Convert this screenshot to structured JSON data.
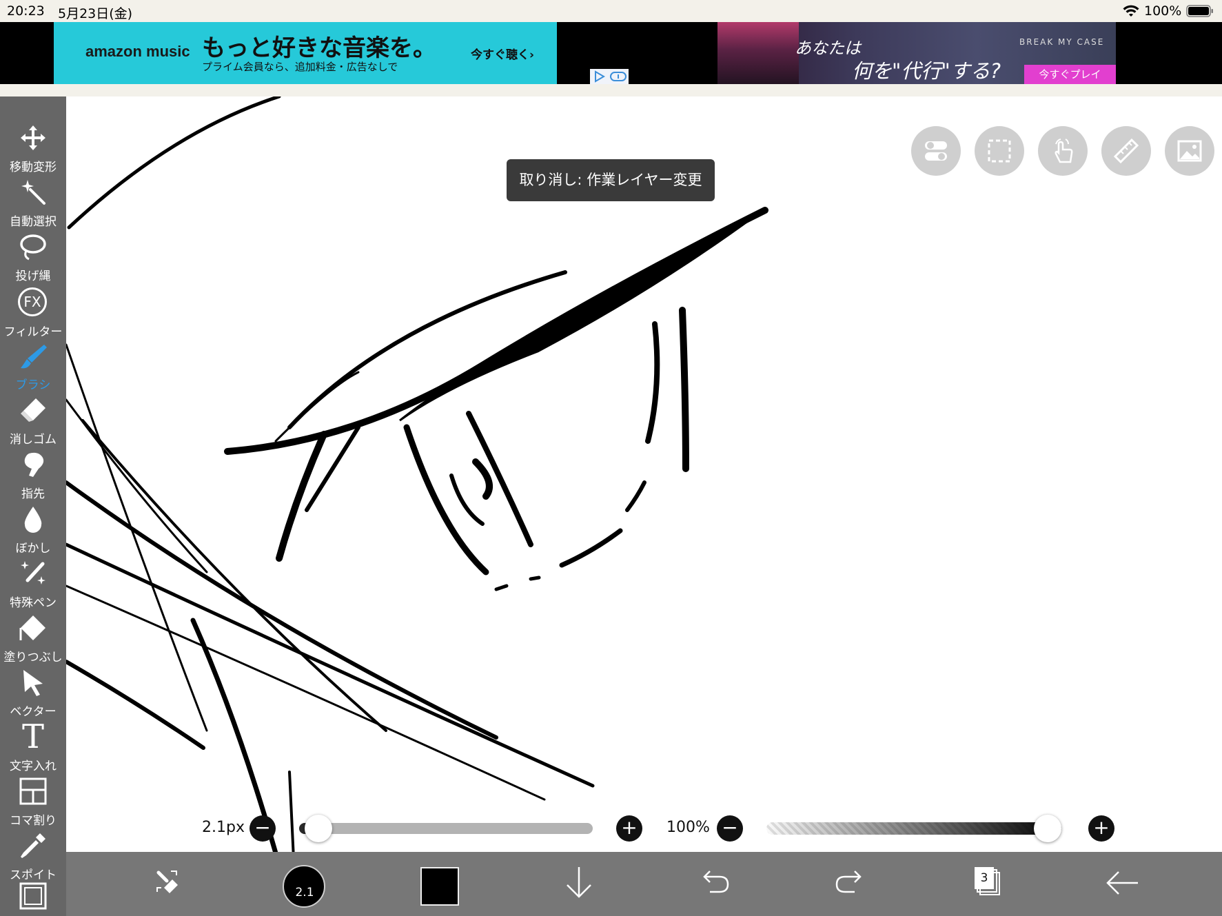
{
  "status_bar": {
    "time": "20:23",
    "date": "5月23日(金)",
    "battery_percent": "100%"
  },
  "ads": {
    "ad1": {
      "brand": "amazon music",
      "headline": "もっと好きな音楽を。",
      "sub": "プライム会員なら、追加料金・広告なしで",
      "cta": "今すぐ聴く›"
    },
    "ad2": {
      "line1": "あなたは",
      "line2": "何を\"代行\"する?",
      "logo": "BREAK MY CASE",
      "cta": "今すぐプレイ"
    }
  },
  "toolbar": {
    "tools": [
      {
        "label": "移動変形",
        "icon": "move-icon"
      },
      {
        "label": "自動選択",
        "icon": "magic-wand-icon"
      },
      {
        "label": "投げ縄",
        "icon": "lasso-icon"
      },
      {
        "label": "フィルター",
        "icon": "fx-icon",
        "glyph": "FX"
      },
      {
        "label": "ブラシ",
        "icon": "brush-icon",
        "active": true
      },
      {
        "label": "消しゴム",
        "icon": "eraser-icon"
      },
      {
        "label": "指先",
        "icon": "smudge-icon"
      },
      {
        "label": "ぼかし",
        "icon": "blur-drop-icon"
      },
      {
        "label": "特殊ペン",
        "icon": "special-pen-icon"
      },
      {
        "label": "塗りつぶし",
        "icon": "fill-bucket-icon"
      },
      {
        "label": "ベクター",
        "icon": "vector-cursor-icon"
      },
      {
        "label": "文字入れ",
        "icon": "text-icon",
        "glyph": "T"
      },
      {
        "label": "コマ割り",
        "icon": "panel-divide-icon"
      },
      {
        "label": "スポイト",
        "icon": "eyedropper-icon"
      },
      {
        "label": "",
        "icon": "canvas-frame-icon"
      }
    ],
    "active_color": "#2d9ae6"
  },
  "toast": {
    "text": "取り消し: 作業レイヤー変更"
  },
  "top_right_buttons": [
    "toggle-icon",
    "selection-rect-icon",
    "touch-hand-icon",
    "ruler-icon",
    "image-icon"
  ],
  "brush_size": {
    "label": "2.1px",
    "value_fraction": 0.02
  },
  "opacity": {
    "label": "100%",
    "value_fraction": 1.0
  },
  "bottom_bar": {
    "brush_size_badge": "2.1",
    "current_color": "#000000",
    "layer_count": "3"
  }
}
